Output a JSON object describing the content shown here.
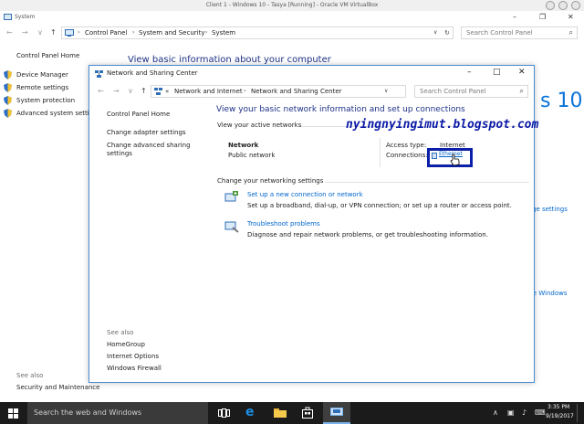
{
  "host": {
    "title": "Client 1 - Windows 10 - Tasya [Running] - Oracle VM VirtualBox"
  },
  "system_window": {
    "title": "System",
    "breadcrumbs": [
      "Control Panel",
      "System and Security",
      "System"
    ],
    "search_placeholder": "Search Control Panel",
    "sidebar_home": "Control Panel Home",
    "sidebar_items": [
      "Device Manager",
      "Remote settings",
      "System protection",
      "Advanced system settings"
    ],
    "heading": "View basic information about your computer",
    "win10_text": "s 10",
    "change_settings_text": "ge settings",
    "activate_text": "te Windows",
    "see_also_label": "See also",
    "see_also_items": [
      "Security and Maintenance"
    ]
  },
  "nsc_window": {
    "title": "Network and Sharing Center",
    "breadcrumbs": [
      "«",
      "Network and Internet",
      "Network and Sharing Center"
    ],
    "search_placeholder": "Search Control Panel",
    "left_home": "Control Panel Home",
    "left_links": [
      "Change adapter settings",
      "Change advanced sharing settings"
    ],
    "see_also_label": "See also",
    "see_also_items": [
      "HomeGroup",
      "Internet Options",
      "Windows Firewall"
    ],
    "heading": "View your basic network information and set up connections",
    "active_networks_label": "View your active networks",
    "network_name": "Network",
    "network_type": "Public network",
    "access_type_label": "Access type:",
    "access_type_value": "Internet",
    "connections_label": "Connections:",
    "connection_value": "Ethernet",
    "change_settings_label": "Change your networking settings",
    "tasks": [
      {
        "link": "Set up a new connection or network",
        "desc": "Set up a broadband, dial-up, or VPN connection; or set up a router or access point."
      },
      {
        "link": "Troubleshoot problems",
        "desc": "Diagnose and repair network problems, or get troubleshooting information."
      }
    ]
  },
  "watermark": "nyingnyingimut.blogspot.com",
  "taskbar": {
    "search_text": "Search the web and Windows",
    "time": "3:35 PM",
    "date": "9/19/2017"
  },
  "colors": {
    "link": "#0066cc",
    "heading": "#1e3287",
    "highlight_box": "#0b1fa8",
    "taskbar": "#1b1b1b"
  }
}
